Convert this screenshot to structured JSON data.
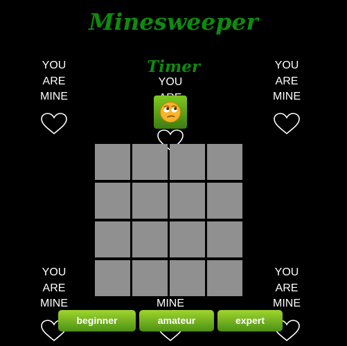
{
  "app": {
    "title": "Minesweeper",
    "timer_label": "Timer",
    "face_state": "rolling-eyes-face"
  },
  "decorations": {
    "line1": "YOU",
    "line2": "ARE",
    "line3": "MINE",
    "heart_icon": "heart-outline-icon"
  },
  "board": {
    "rows": 4,
    "cols": 4,
    "cell_state": "unrevealed"
  },
  "levels": {
    "beginner": "beginner",
    "amateur": "amateur",
    "expert": "expert"
  },
  "colors": {
    "title": "#0e8a0e",
    "cell": "#909090",
    "button": "#6fb51e",
    "background": "#000000"
  }
}
